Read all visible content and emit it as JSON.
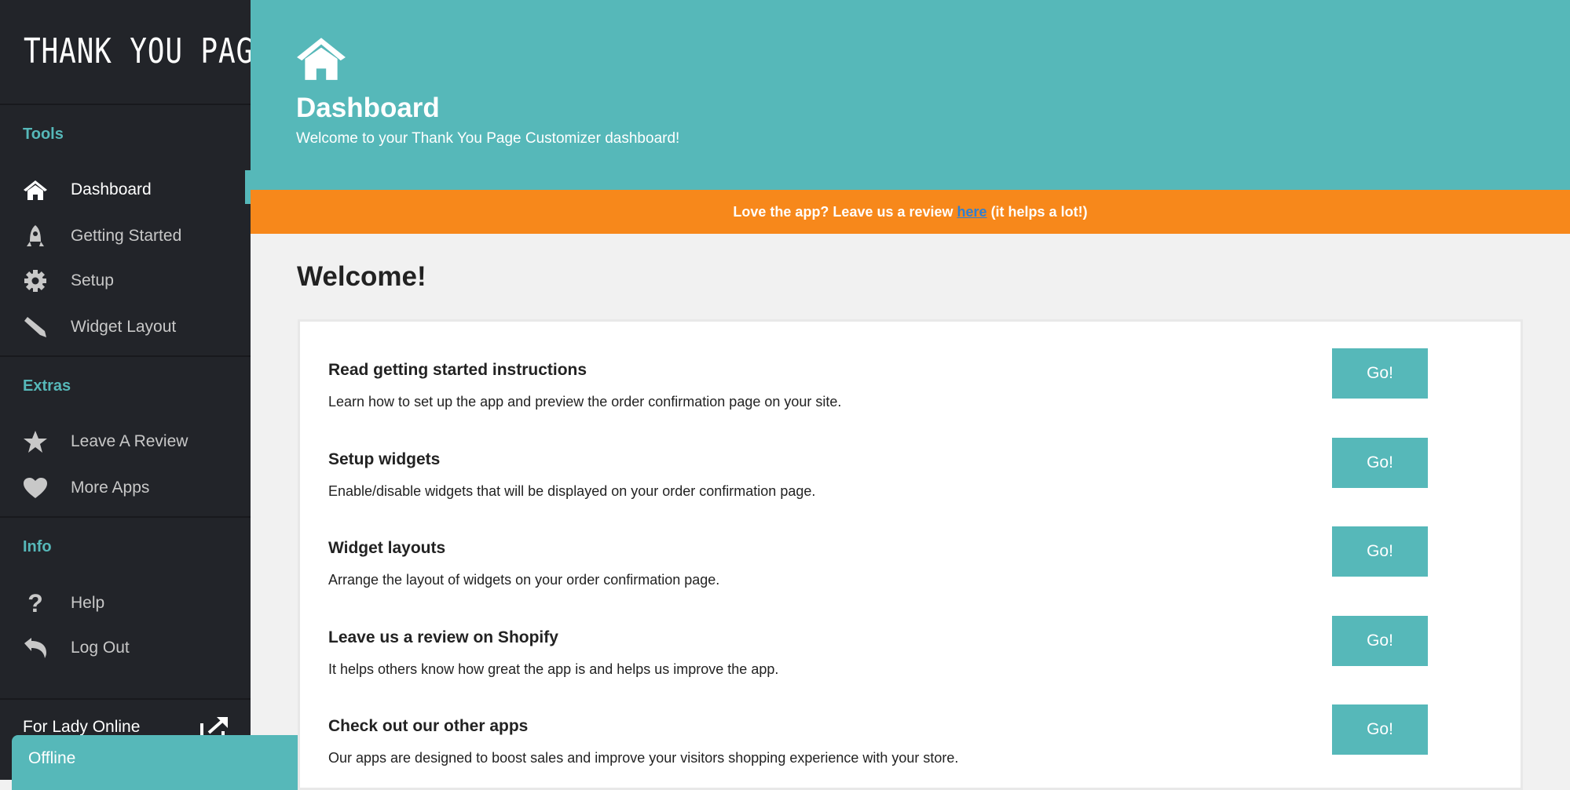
{
  "sidebar": {
    "logo": "THANK YOU PAGE",
    "sections": [
      {
        "title": "Tools",
        "items": [
          {
            "label": "Dashboard",
            "icon": "home-icon",
            "active": true
          },
          {
            "label": "Getting Started",
            "icon": "rocket-icon"
          },
          {
            "label": "Setup",
            "icon": "gear-icon"
          },
          {
            "label": "Widget Layout",
            "icon": "pencil-icon"
          }
        ]
      },
      {
        "title": "Extras",
        "items": [
          {
            "label": "Leave A Review",
            "icon": "star-icon"
          },
          {
            "label": "More Apps",
            "icon": "heart-icon"
          }
        ]
      },
      {
        "title": "Info",
        "items": [
          {
            "label": "Help",
            "icon": "question-icon"
          },
          {
            "label": "Log Out",
            "icon": "undo-icon"
          }
        ]
      }
    ],
    "store_name": "For Lady Online",
    "status": "Offline"
  },
  "header": {
    "title": "Dashboard",
    "subtitle": "Welcome to your Thank You Page Customizer dashboard!"
  },
  "banner": {
    "prefix": "Love the app? Leave us a review ",
    "link": "here",
    "suffix": " (it helps a lot!)"
  },
  "main": {
    "heading": "Welcome!",
    "rows": [
      {
        "title": "Read getting started instructions",
        "desc": "Learn how to set up the app and preview the order confirmation page on your site.",
        "button": "Go!"
      },
      {
        "title": "Setup widgets",
        "desc": "Enable/disable widgets that will be displayed on your order confirmation page.",
        "button": "Go!"
      },
      {
        "title": "Widget layouts",
        "desc": "Arrange the layout of widgets on your order confirmation page.",
        "button": "Go!"
      },
      {
        "title": "Leave us a review on Shopify",
        "desc": "It helps others know how great the app is and helps us improve the app.",
        "button": "Go!"
      },
      {
        "title": "Check out our other apps",
        "desc": "Our apps are designed to boost sales and improve your visitors shopping experience with your store.",
        "button": "Go!"
      }
    ]
  },
  "colors": {
    "accent": "#56b8b9",
    "banner": "#f7881b",
    "sidebar": "#222429"
  }
}
